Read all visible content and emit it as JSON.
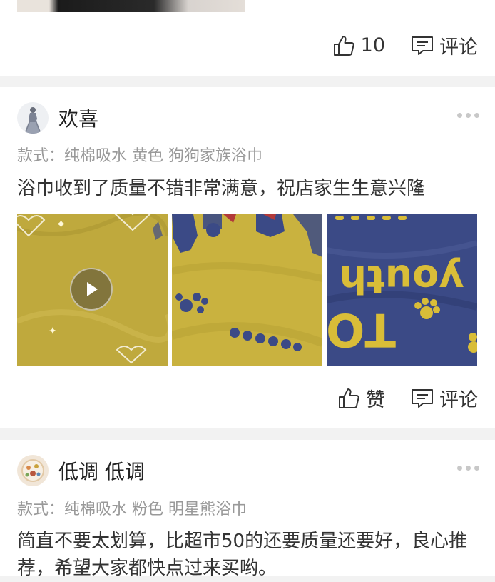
{
  "top_card": {
    "like_count": "10",
    "comment_label": "评论"
  },
  "reviews": [
    {
      "username": "欢喜",
      "spec": "款式：纯棉吸水 黄色 狗狗家族浴巾",
      "content": "浴巾收到了质量不错非常满意，祝店家生生意兴隆",
      "like_label": "赞",
      "comment_label": "评论",
      "photo_texts": [
        "youth",
        "TO"
      ]
    },
    {
      "username": "低调 低调",
      "spec": "款式：纯棉吸水 粉色 明星熊浴巾",
      "content": "简直不要太划算，比超市50的还要质量还要好，良心推荐，希望大家都快点过来买哟。"
    }
  ],
  "colors": {
    "towel_yellow": "#c8b13f",
    "towel_navy": "#3b4a86",
    "page_bg": "#f2f2f2"
  }
}
